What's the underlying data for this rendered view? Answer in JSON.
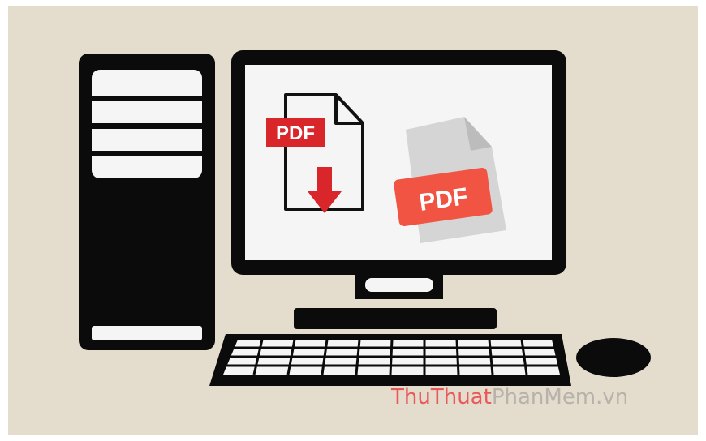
{
  "colors": {
    "background": "#e4ddcd",
    "device": "#0b0b0b",
    "screen": "#f5f5f5",
    "pdf_red": "#d8262b",
    "pdf_orange_red": "#f25443",
    "file_gray": "#dcdcdc",
    "watermark_red": "#e85a5a",
    "watermark_gray": "#b7b2aa"
  },
  "icons": {
    "left_file": "pdf-download-icon",
    "right_file": "pdf-file-icon"
  },
  "left_pdf_label": "PDF",
  "right_pdf_label": "PDF",
  "watermark": {
    "part1": "ThuThuat",
    "part2": "PhanMem",
    "part3": ".vn"
  }
}
